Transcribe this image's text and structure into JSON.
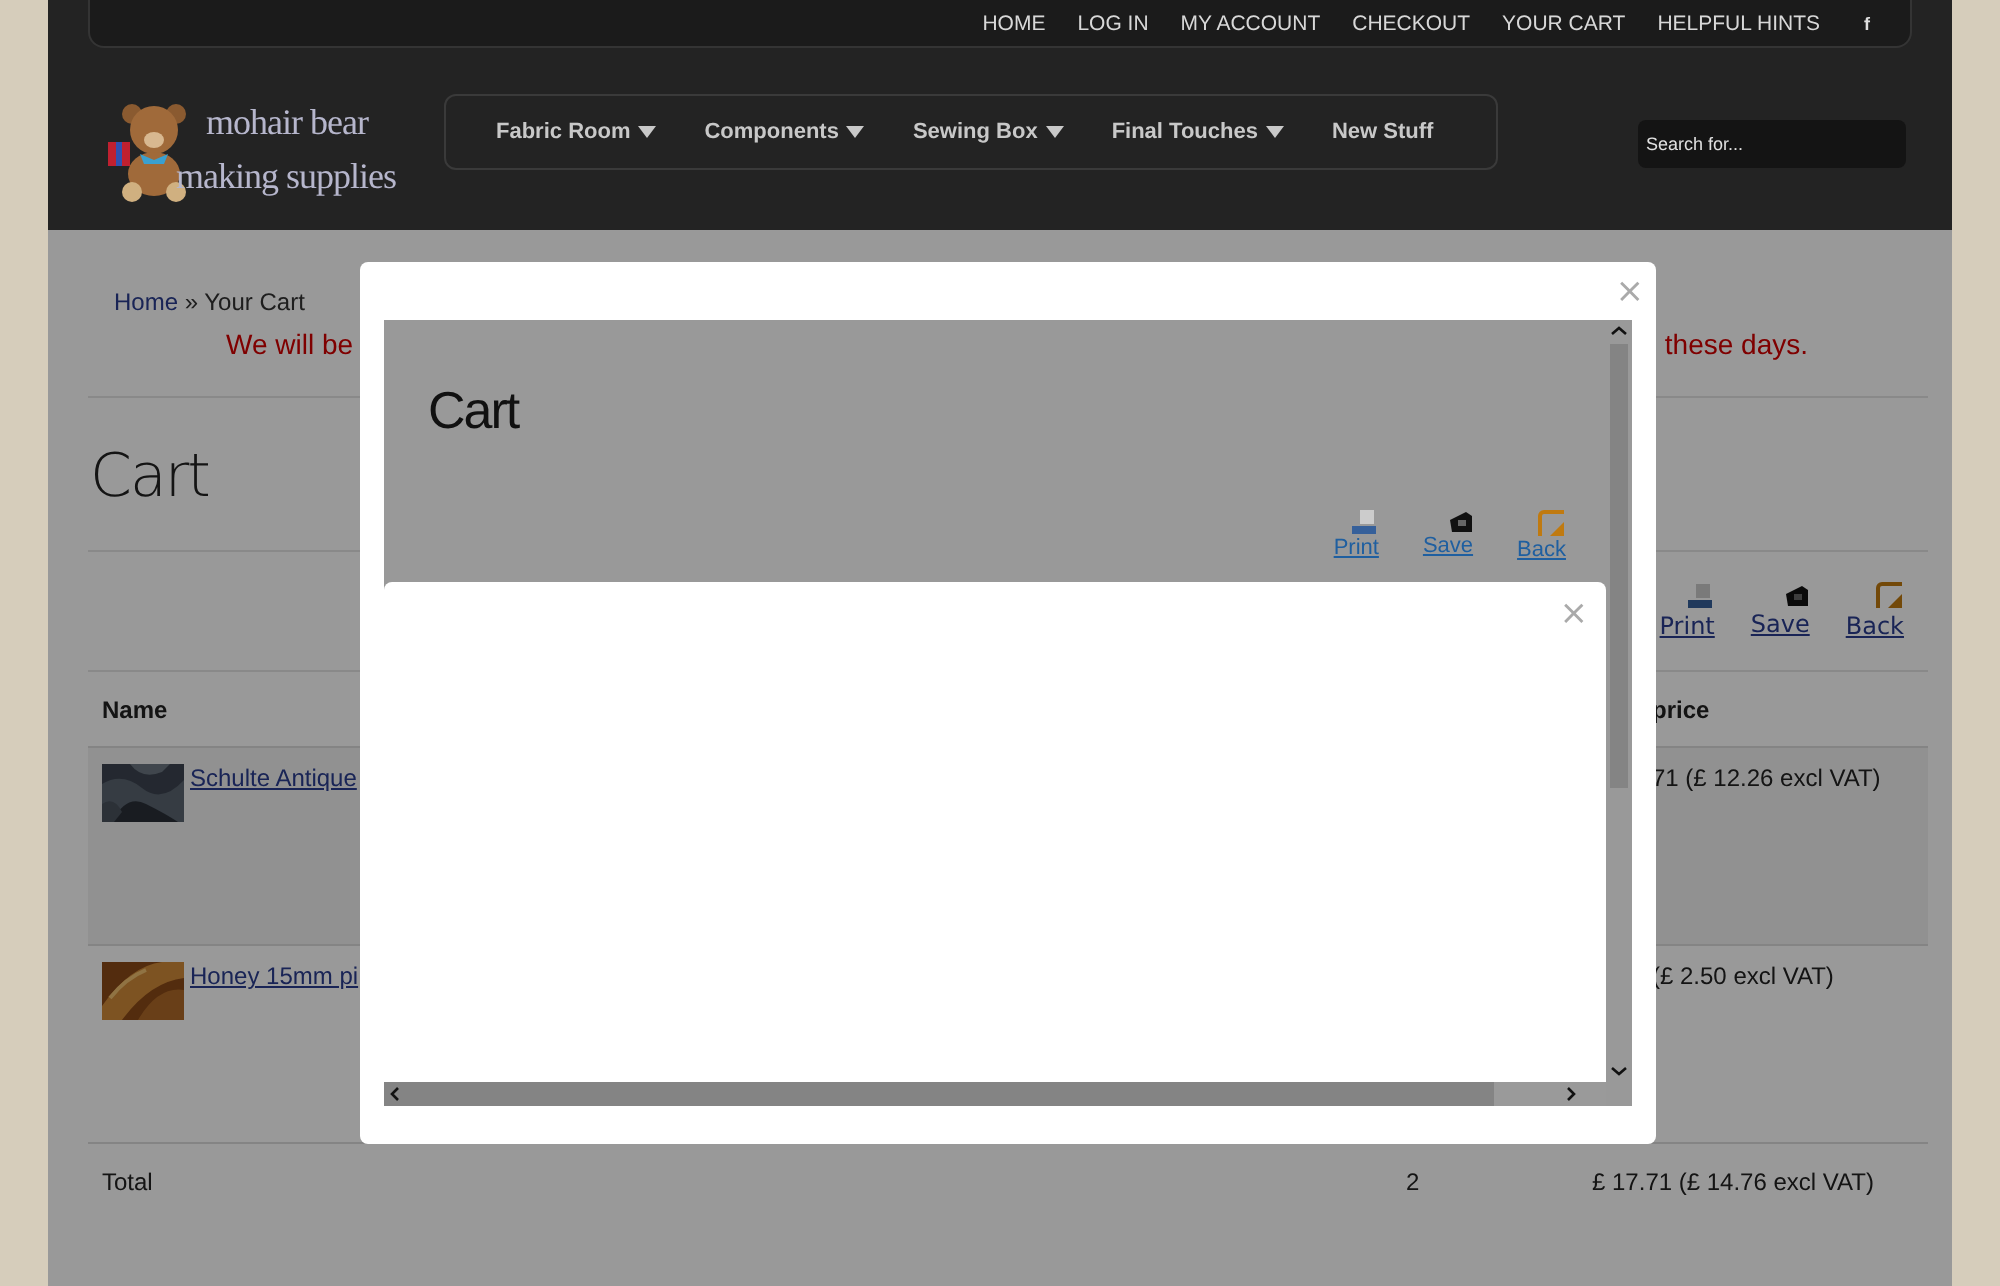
{
  "top_links": [
    "HOME",
    "LOG IN",
    "MY ACCOUNT",
    "CHECKOUT",
    "YOUR CART",
    "HELPFUL HINTS"
  ],
  "social": "f",
  "logo": {
    "line1": "mohair bear",
    "line2": "making supplies"
  },
  "nav": [
    {
      "label": "Fabric Room",
      "has_submenu": true
    },
    {
      "label": "Components",
      "has_submenu": true
    },
    {
      "label": "Sewing Box",
      "has_submenu": true
    },
    {
      "label": "Final Touches",
      "has_submenu": true
    },
    {
      "label": "New Stuff",
      "has_submenu": false
    }
  ],
  "search": {
    "placeholder": "Search for..."
  },
  "breadcrumb": {
    "link": "Home",
    "current": "» Your Cart"
  },
  "notice": {
    "before_modal": "We will be",
    "after_modal": "these days."
  },
  "page_title": "Cart",
  "actions": [
    {
      "kind": "print",
      "label": "Print"
    },
    {
      "kind": "save",
      "label": "Save"
    },
    {
      "kind": "back",
      "label": "Back"
    }
  ],
  "table": {
    "columns": [
      "Name",
      "price"
    ],
    "rows": [
      {
        "name": "Schulte Antique",
        "price": "71 (£ 12.26 excl VAT)"
      },
      {
        "name": "Honey 15mm pi",
        "price": "(£ 2.50 excl VAT)"
      }
    ],
    "total": {
      "label": "Total",
      "quantity": "2",
      "price": "£ 17.71 (£ 14.76 excl VAT)"
    }
  },
  "modal": {
    "close": "×",
    "frame": {
      "title": "Cart",
      "actions": [
        {
          "kind": "print",
          "label": "Print"
        },
        {
          "kind": "save",
          "label": "Save"
        },
        {
          "kind": "back",
          "label": "Back"
        }
      ],
      "dialog": {
        "close": "×"
      }
    }
  }
}
